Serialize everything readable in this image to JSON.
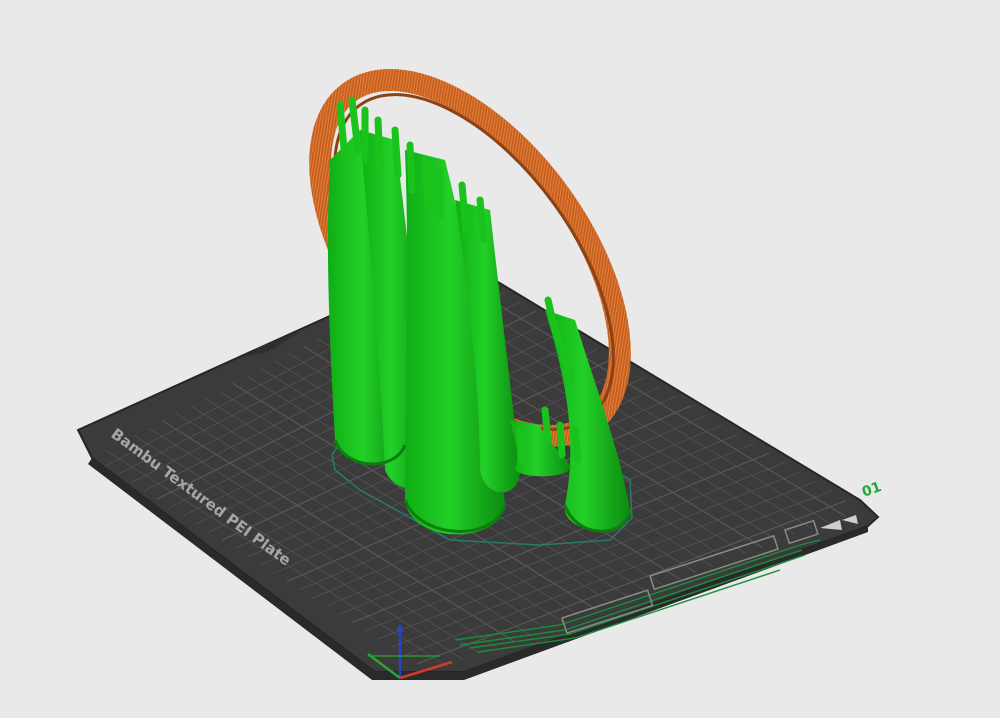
{
  "plate": {
    "label": "Bambu Textured PEI Plate",
    "number": "01",
    "colors": {
      "background": "#e9e9e9",
      "plate_dark": "#3b3b3b",
      "plate_rim": "#2a2a2a",
      "grid_line": "#5a5a5a",
      "plate_text": "#a6a6a6",
      "plate_number": "#1ea83c",
      "marker_green": "#1a8f3a"
    }
  },
  "model": {
    "ring_color": "#d46a24",
    "ring_shadow": "#8a4216",
    "support_color": "#19c31c",
    "support_shadow": "#0c7e0f",
    "outline_color": "#2a7a6a",
    "support_count": 6
  },
  "axes": {
    "x_color": "#d23a2c",
    "y_color": "#27a534",
    "z_color": "#2743c9"
  }
}
